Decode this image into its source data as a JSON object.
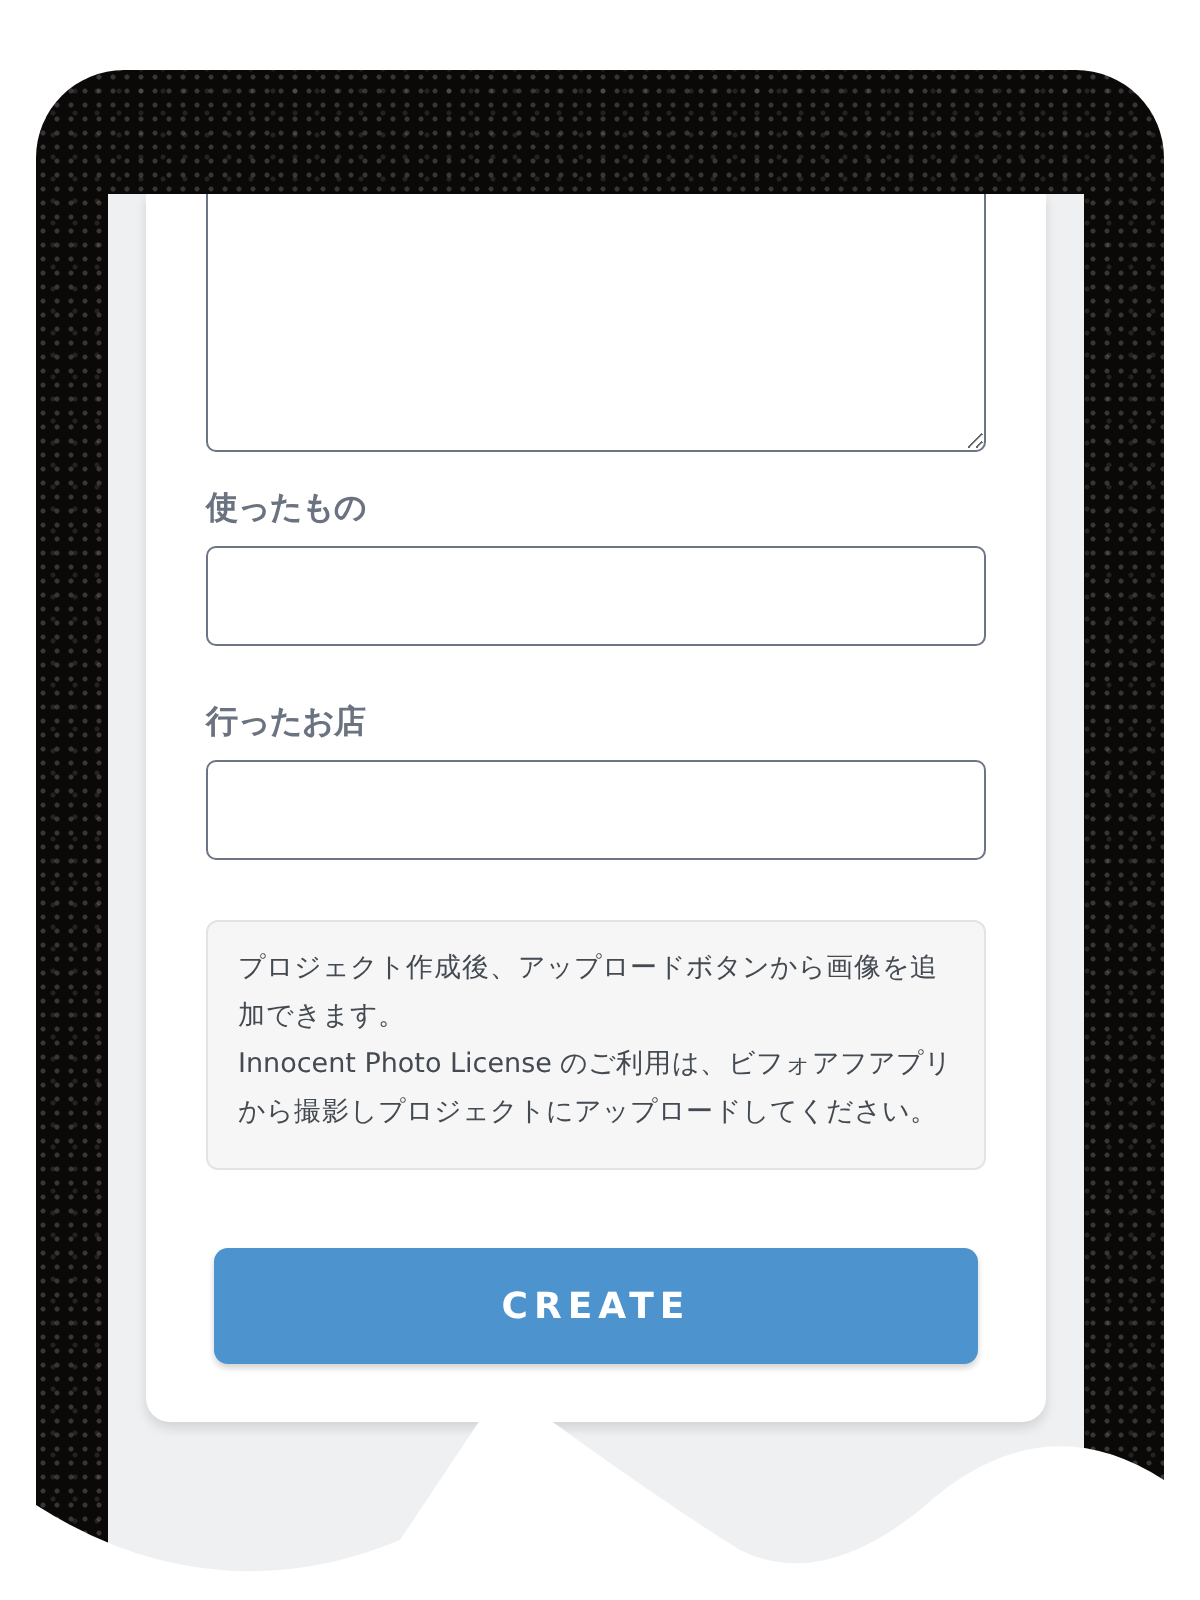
{
  "form": {
    "fields": [
      {
        "kind": "textarea"
      },
      {
        "kind": "input",
        "label": "使ったもの"
      },
      {
        "kind": "input",
        "label": "行ったお店"
      }
    ],
    "notice": [
      "プロジェクト作成後、アップロードボタンから画像を追加できます。",
      "Innocent Photo License のご利用は、ビフォアフアプリから撮影しプロジェクトにアップロードしてください。"
    ],
    "submit_button": "CREATE"
  }
}
